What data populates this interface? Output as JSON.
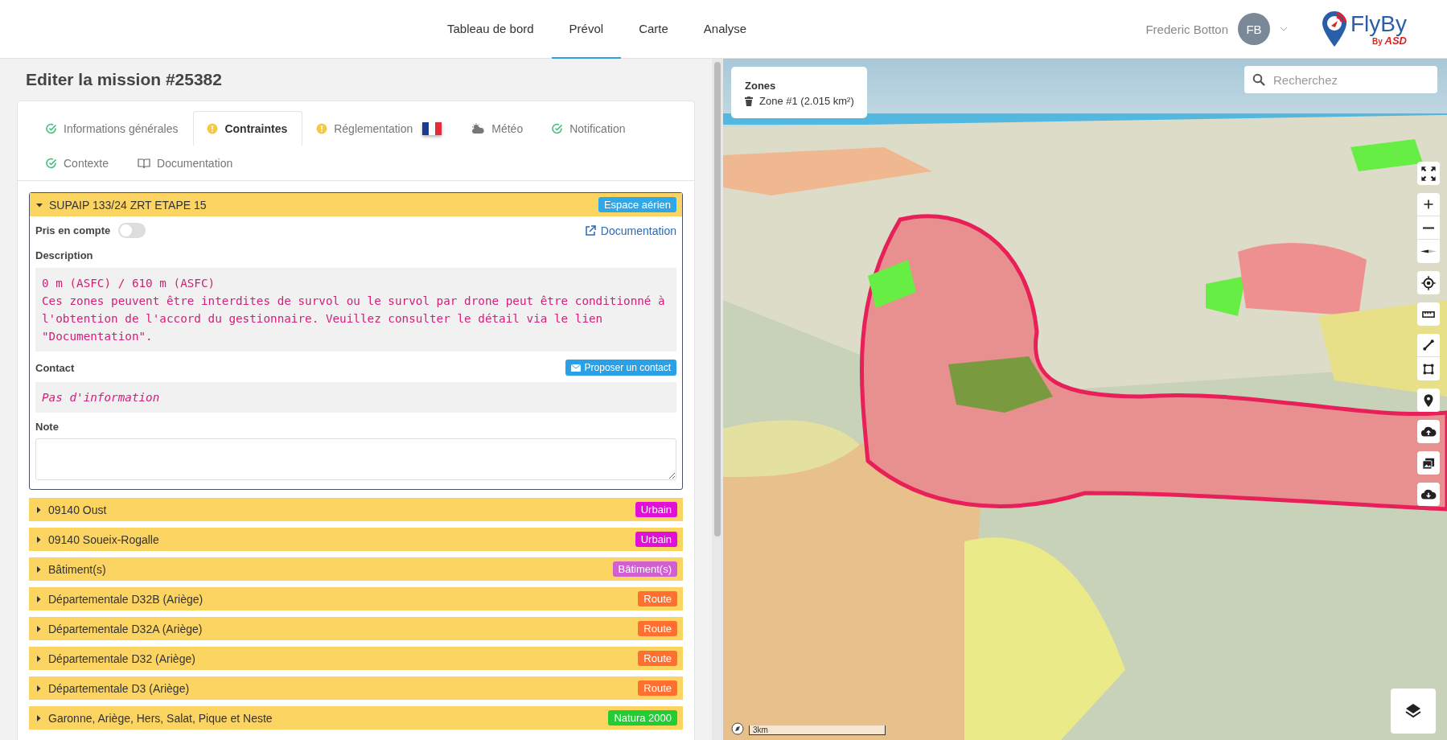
{
  "nav": {
    "items": [
      {
        "label": "Tableau de bord",
        "selected": false
      },
      {
        "label": "Prévol",
        "selected": true
      },
      {
        "label": "Carte",
        "selected": false
      },
      {
        "label": "Analyse",
        "selected": false
      }
    ]
  },
  "user": {
    "name": "Frederic Botton",
    "initials": "FB"
  },
  "logo": {
    "name": "FlyBy",
    "by": "By",
    "brand": "ASD"
  },
  "page_title": "Editer la mission #25382",
  "tabs": [
    {
      "label": "Informations générales",
      "kind": "check",
      "selected": false
    },
    {
      "label": "Contraintes",
      "kind": "warning",
      "selected": true
    },
    {
      "label": "Réglementation",
      "kind": "warning",
      "selected": false,
      "flag": true
    },
    {
      "label": "Météo",
      "kind": "cloud",
      "selected": false
    },
    {
      "label": "Notification",
      "kind": "check",
      "selected": false
    },
    {
      "label": "Contexte",
      "kind": "check",
      "selected": false
    },
    {
      "label": "Documentation",
      "kind": "book",
      "selected": false
    }
  ],
  "constraints": [
    {
      "title": "SUPAIP 133/24 ZRT ETAPE 15",
      "tag": "Espace aérien",
      "color": "#2ea8e8",
      "expanded": true,
      "taken_into_account_label": "Pris en compte",
      "taken_into_account": false,
      "doc_link": "Documentation",
      "description_label": "Description",
      "description": [
        "0 m (ASFC) / 610 m (ASFC)",
        "Ces zones peuvent être interdites de survol ou le survol par drone peut être conditionné à l'obtention de l'accord du gestionnaire. Veuillez consulter le détail via le lien \"Documentation\"."
      ],
      "contact_label": "Contact",
      "contact_button": "Proposer un contact",
      "contact": "Pas d'information",
      "note_label": "Note"
    },
    {
      "title": "09140 Oust",
      "tag": "Urbain",
      "color": "#e010d8",
      "expanded": false
    },
    {
      "title": "09140 Soueix-Rogalle",
      "tag": "Urbain",
      "color": "#e010d8",
      "expanded": false
    },
    {
      "title": "Bâtiment(s)",
      "tag": "Bâtiment(s)",
      "color": "#d060d0",
      "expanded": false
    },
    {
      "title": "Départementale D32B (Ariège)",
      "tag": "Route",
      "color": "#ff7030",
      "expanded": false
    },
    {
      "title": "Départementale D32A (Ariège)",
      "tag": "Route",
      "color": "#ff7030",
      "expanded": false
    },
    {
      "title": "Départementale D32 (Ariège)",
      "tag": "Route",
      "color": "#ff7030",
      "expanded": false
    },
    {
      "title": "Départementale D3 (Ariège)",
      "tag": "Route",
      "color": "#ff7030",
      "expanded": false
    },
    {
      "title": "Garonne, Ariège, Hers, Salat, Pique et Neste",
      "tag": "Natura 2000",
      "color": "#22cc33",
      "expanded": false
    }
  ],
  "map": {
    "zones_title": "Zones",
    "zones": [
      "Zone #1 (2.015 km²)"
    ],
    "search_placeholder": "Recherchez",
    "scale": "3km"
  }
}
